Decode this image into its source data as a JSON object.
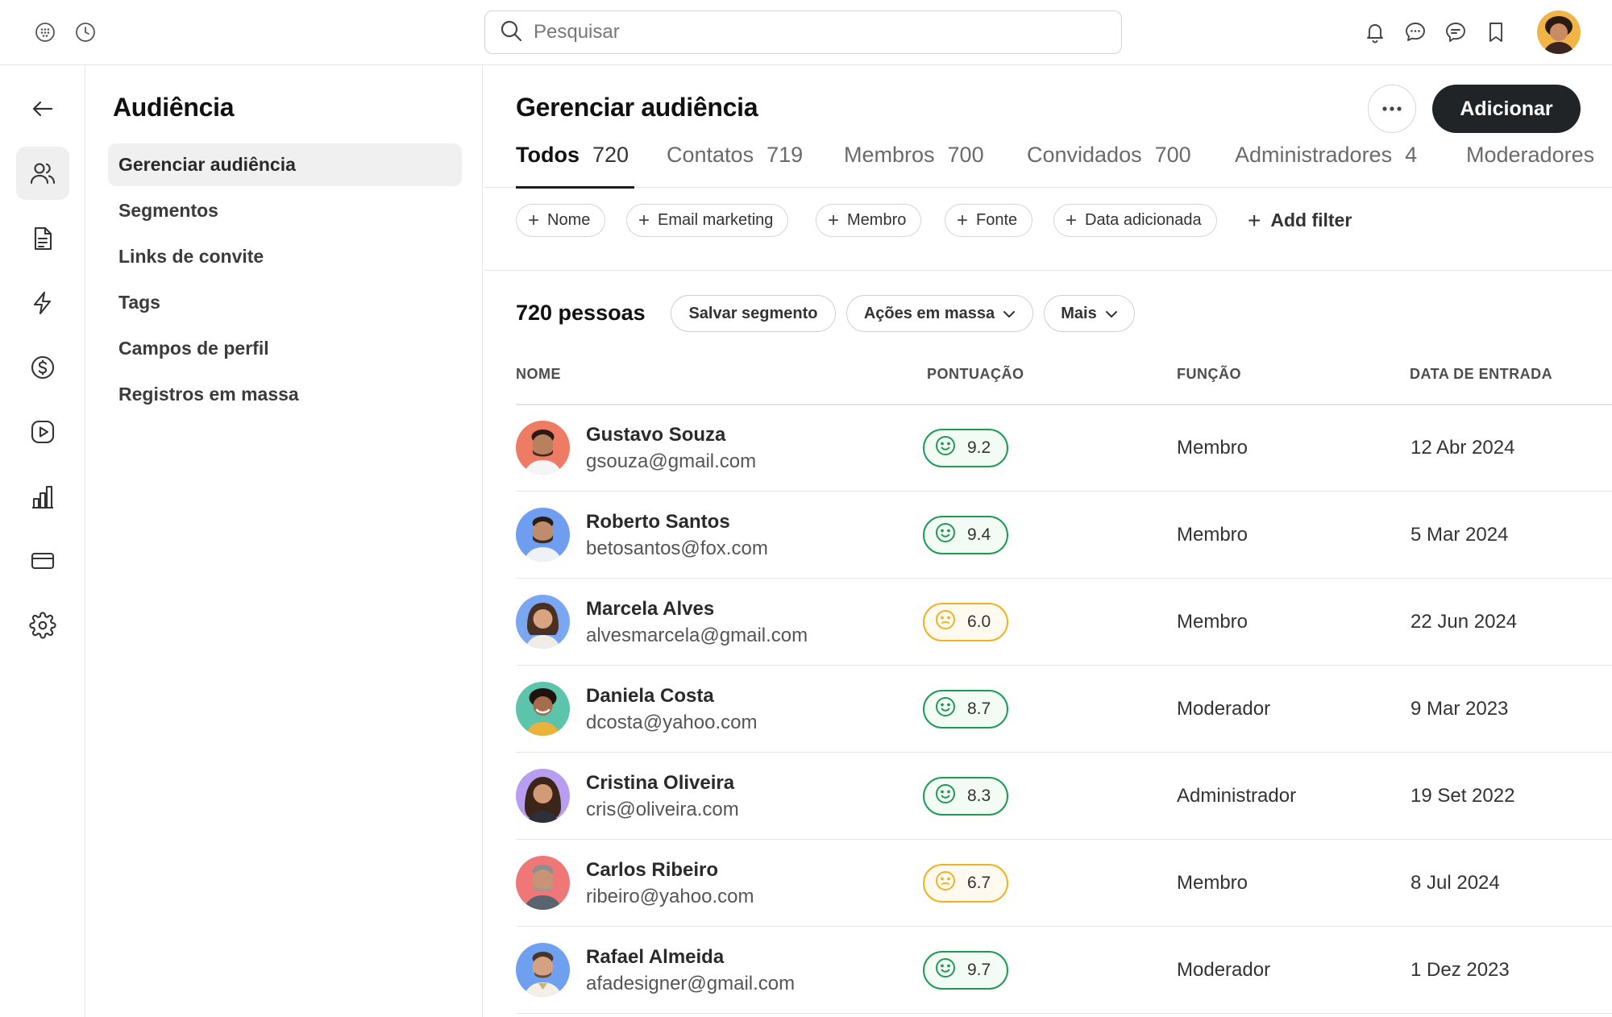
{
  "search": {
    "placeholder": "Pesquisar"
  },
  "sidebar": {
    "title": "Audiência",
    "items": [
      {
        "label": "Gerenciar audiência"
      },
      {
        "label": "Segmentos"
      },
      {
        "label": "Links de convite"
      },
      {
        "label": "Tags"
      },
      {
        "label": "Campos de perfil"
      },
      {
        "label": "Registros em massa"
      }
    ]
  },
  "main": {
    "title": "Gerenciar audiência",
    "add_label": "Adicionar",
    "tabs": [
      {
        "label": "Todos",
        "count": "720"
      },
      {
        "label": "Contatos",
        "count": "719"
      },
      {
        "label": "Membros",
        "count": "700"
      },
      {
        "label": "Convidados",
        "count": "700"
      },
      {
        "label": "Administradores",
        "count": "4"
      },
      {
        "label": "Moderadores",
        "count": ""
      }
    ],
    "filters": [
      "Nome",
      "Email marketing",
      "Membro",
      "Fonte",
      "Data adicionada"
    ],
    "add_filter_label": "Add filter",
    "people_count": "720 pessoas",
    "save_segment_label": "Salvar segmento",
    "bulk_actions_label": "Ações em massa",
    "more_label": "Mais",
    "columns": {
      "name": "NOME",
      "score": "PONTUAÇÃO",
      "role": "FUNÇÃO",
      "date": "DATA DE ENTRADA"
    },
    "rows": [
      {
        "name": "Gustavo Souza",
        "email": "gsouza@gmail.com",
        "score": "9.2",
        "score_level": 0.92,
        "role": "Membro",
        "date": "12 Abr 2024"
      },
      {
        "name": "Roberto Santos",
        "email": "betosantos@fox.com",
        "score": "9.4",
        "score_level": 0.94,
        "role": "Membro",
        "date": "5 Mar 2024"
      },
      {
        "name": "Marcela Alves",
        "email": "alvesmarcela@gmail.com",
        "score": "6.0",
        "score_level": 0.6,
        "role": "Membro",
        "date": "22 Jun 2024"
      },
      {
        "name": "Daniela Costa",
        "email": "dcosta@yahoo.com",
        "score": "8.7",
        "score_level": 0.87,
        "role": "Moderador",
        "date": "9 Mar 2023"
      },
      {
        "name": "Cristina Oliveira",
        "email": "cris@oliveira.com",
        "score": "8.3",
        "score_level": 0.83,
        "role": "Administrador",
        "date": "19 Set 2022"
      },
      {
        "name": "Carlos Ribeiro",
        "email": "ribeiro@yahoo.com",
        "score": "6.7",
        "score_level": 0.67,
        "role": "Membro",
        "date": "8 Jul 2024"
      },
      {
        "name": "Rafael Almeida",
        "email": "afadesigner@gmail.com",
        "score": "9.7",
        "score_level": 0.97,
        "role": "Moderador",
        "date": "1 Dez 2023"
      }
    ]
  },
  "colors": {
    "primary_button": "#212427",
    "score_good": "#1f9a55",
    "score_mid": "#f0b21f",
    "active_bg": "#efefef"
  },
  "icons": {
    "topbar": [
      "apps-grid-icon",
      "clock-icon",
      "bell-icon",
      "chat-bubble-icon",
      "chat-lines-icon",
      "bookmark-icon"
    ],
    "rail": [
      "back-arrow-icon",
      "users-icon",
      "document-icon",
      "lightning-icon",
      "dollar-icon",
      "play-icon",
      "bar-chart-icon",
      "card-icon",
      "gear-icon"
    ]
  }
}
